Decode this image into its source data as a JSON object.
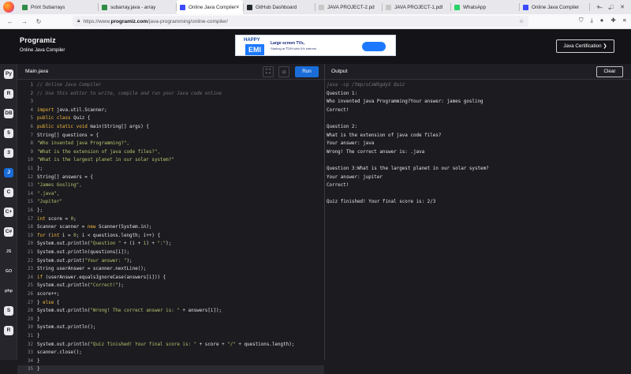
{
  "browser": {
    "tabs": [
      {
        "label": "Print Subarrays",
        "favicon_color": "#2f8d46",
        "active": false
      },
      {
        "label": "subarray.java - array",
        "favicon_color": "#2f8d46",
        "active": false
      },
      {
        "label": "Online Java Compiler",
        "favicon_color": "#3b4cff",
        "active": true
      },
      {
        "label": "GitHub Dashboard",
        "favicon_color": "#24292f",
        "active": false
      },
      {
        "label": "JAVA PROJECT-2.pdf",
        "favicon_color": "#c7c7c7",
        "active": false
      },
      {
        "label": "JAVA PROJECT-1.pdf",
        "favicon_color": "#c7c7c7",
        "active": false
      },
      {
        "label": "WhatsApp",
        "favicon_color": "#25d366",
        "active": false
      },
      {
        "label": "Online Java Compiler",
        "favicon_color": "#3b4cff",
        "active": false
      }
    ],
    "url_prefix": "https://www.",
    "url_domain": "programiz.com",
    "url_path": "/java-programming/online-compiler/"
  },
  "site": {
    "logo": "Programiz",
    "subtitle": "Online Java Compiler",
    "cert_button": "Java Certification ❯"
  },
  "ad": {
    "happy": "HAPPY",
    "emi": "EMI",
    "line1": "Large screen TVs,",
    "line2": "Starting at ₹299 with 0% interest"
  },
  "editor": {
    "file_tab": "Main.java",
    "run_label": "Run",
    "lines": [
      [
        {
          "t": "// Online Java Compiler",
          "c": "cm"
        }
      ],
      [
        {
          "t": "// Use this editor to write, compile and run your Java code online",
          "c": "cm"
        }
      ],
      [],
      [
        {
          "t": "import",
          "c": "kw"
        },
        {
          "t": " java.util.Scanner;"
        }
      ],
      [
        {
          "t": "public",
          "c": "kw"
        },
        {
          "t": " "
        },
        {
          "t": "class",
          "c": "kw"
        },
        {
          "t": " Quiz {"
        }
      ],
      [
        {
          "t": "public",
          "c": "kw"
        },
        {
          "t": " "
        },
        {
          "t": "static",
          "c": "kw"
        },
        {
          "t": " "
        },
        {
          "t": "void",
          "c": "kw"
        },
        {
          "t": " main(String[] args) {"
        }
      ],
      [
        {
          "t": "String[] questions = {"
        }
      ],
      [
        {
          "t": "\"Who invented java Programming?\",",
          "c": "st"
        }
      ],
      [
        {
          "t": "\"What is the extension of java code files?\",",
          "c": "st"
        }
      ],
      [
        {
          "t": "\"What is the largest planet in our solar system?\"",
          "c": "st"
        }
      ],
      [
        {
          "t": "};"
        }
      ],
      [
        {
          "t": "String[] answers = {"
        }
      ],
      [
        {
          "t": "\"James Gosling\",",
          "c": "st"
        }
      ],
      [
        {
          "t": "\".java\",",
          "c": "st"
        }
      ],
      [
        {
          "t": "\"Jupiter\"",
          "c": "st"
        }
      ],
      [
        {
          "t": "};"
        }
      ],
      [
        {
          "t": "int",
          "c": "kw"
        },
        {
          "t": " score = "
        },
        {
          "t": "0",
          "c": "st"
        },
        {
          "t": ";"
        }
      ],
      [
        {
          "t": "Scanner scanner = "
        },
        {
          "t": "new",
          "c": "kw"
        },
        {
          "t": " Scanner(System.in);"
        }
      ],
      [
        {
          "t": "for",
          "c": "kw"
        },
        {
          "t": " ("
        },
        {
          "t": "int",
          "c": "kw"
        },
        {
          "t": " i = "
        },
        {
          "t": "0",
          "c": "st"
        },
        {
          "t": "; i < questions.length; i++) {"
        }
      ],
      [
        {
          "t": "System.out.println("
        },
        {
          "t": "\"Question \"",
          "c": "st"
        },
        {
          "t": " + (i + "
        },
        {
          "t": "1",
          "c": "st"
        },
        {
          "t": ") + "
        },
        {
          "t": "\":\"",
          "c": "st"
        },
        {
          "t": ");"
        }
      ],
      [
        {
          "t": "System.out.println(questions[i]);"
        }
      ],
      [
        {
          "t": "System.out.print("
        },
        {
          "t": "\"Your answer: \"",
          "c": "st"
        },
        {
          "t": ");"
        }
      ],
      [
        {
          "t": "String userAnswer = scanner.nextLine();"
        }
      ],
      [
        {
          "t": "if",
          "c": "kw"
        },
        {
          "t": " (userAnswer.equalsIgnoreCase(answers[i])) {"
        }
      ],
      [
        {
          "t": "System.out.println("
        },
        {
          "t": "\"Correct!\"",
          "c": "st"
        },
        {
          "t": ");"
        }
      ],
      [
        {
          "t": "score++;"
        }
      ],
      [
        {
          "t": "} "
        },
        {
          "t": "else",
          "c": "kw"
        },
        {
          "t": " {"
        }
      ],
      [
        {
          "t": "System.out.println("
        },
        {
          "t": "\"Wrong! The correct answer is: \"",
          "c": "st"
        },
        {
          "t": " + answers[i]);"
        }
      ],
      [
        {
          "t": "}"
        }
      ],
      [
        {
          "t": "System.out.println();"
        }
      ],
      [
        {
          "t": "}"
        }
      ],
      [
        {
          "t": "System.out.println("
        },
        {
          "t": "\"Quiz finished! Your final score is: \"",
          "c": "st"
        },
        {
          "t": " + score + "
        },
        {
          "t": "\"/\"",
          "c": "st"
        },
        {
          "t": " + questions.length);"
        }
      ],
      [
        {
          "t": "scanner.close();"
        }
      ],
      [
        {
          "t": "}"
        }
      ],
      [
        {
          "t": "}"
        }
      ]
    ]
  },
  "output": {
    "title": "Output",
    "clear_label": "Clear",
    "lines": [
      "java -cp /tmp/sCxW5gdyS Quiz",
      "Question 1:",
      "Who invented java Programming?Your answer: james gosling",
      "Correct!",
      "",
      "Question 2:",
      "What is the extension of java code files?",
      "Your answer: java",
      "Wrong! The correct answer is: .java",
      "",
      "Question 3:What is the largest planet in our solar system?",
      "Your answer: jupiter",
      "Correct!",
      "",
      "Quiz finished! Your final score is: 2/3"
    ]
  },
  "sidebar": {
    "items": [
      {
        "name": "python",
        "label": "Py"
      },
      {
        "name": "r",
        "label": "R"
      },
      {
        "name": "sql",
        "label": "DB"
      },
      {
        "name": "html",
        "label": "5"
      },
      {
        "name": "css",
        "label": "3"
      },
      {
        "name": "java",
        "label": "J",
        "active": true
      },
      {
        "name": "c",
        "label": "C"
      },
      {
        "name": "cpp",
        "label": "C+"
      },
      {
        "name": "csharp",
        "label": "C#"
      },
      {
        "name": "js",
        "label": "JS",
        "txt": true
      },
      {
        "name": "go",
        "label": "GO",
        "txt": true
      },
      {
        "name": "php",
        "label": "php",
        "txt": true
      },
      {
        "name": "swift",
        "label": "S"
      },
      {
        "name": "rust",
        "label": "R"
      }
    ]
  }
}
